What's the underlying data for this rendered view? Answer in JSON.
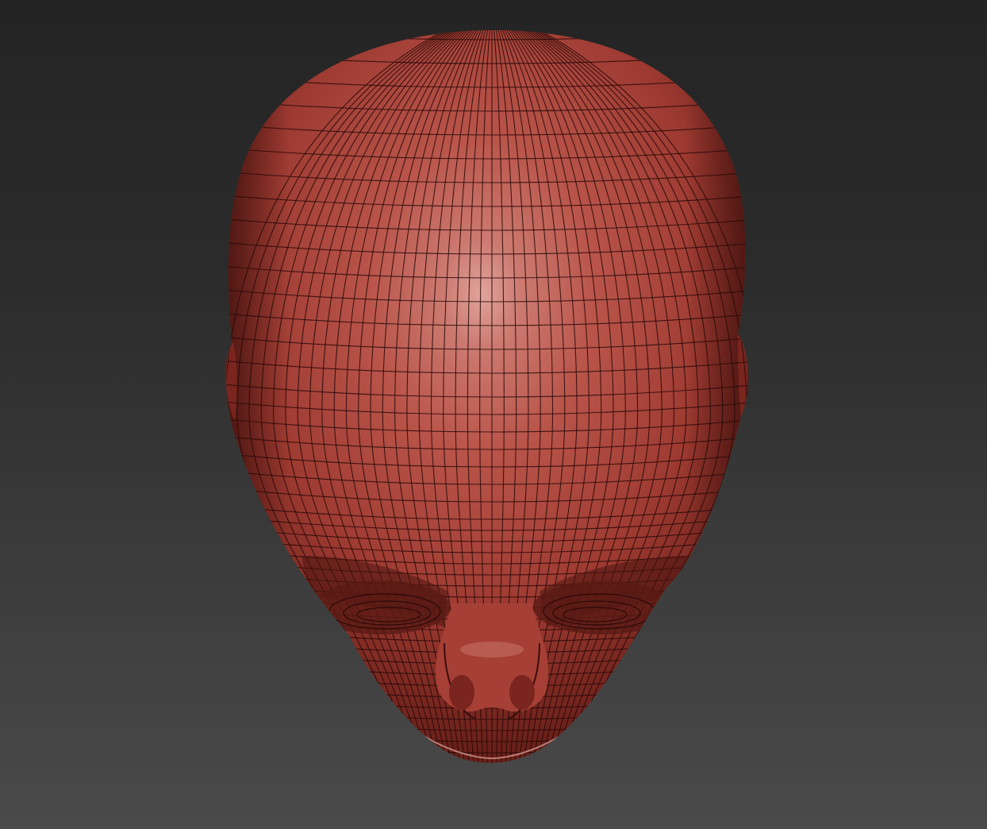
{
  "viewport": {
    "background_top": "#242424",
    "background_bottom": "#4a4a4a"
  },
  "model": {
    "type": "head-mesh",
    "view": "top-down",
    "display": "polyframe-wireframe-overlay",
    "material_color": "#b5473c",
    "highlight_color": "#e8a8a0",
    "shadow_color": "#4a1410",
    "wire_color": "#2a0a08"
  }
}
